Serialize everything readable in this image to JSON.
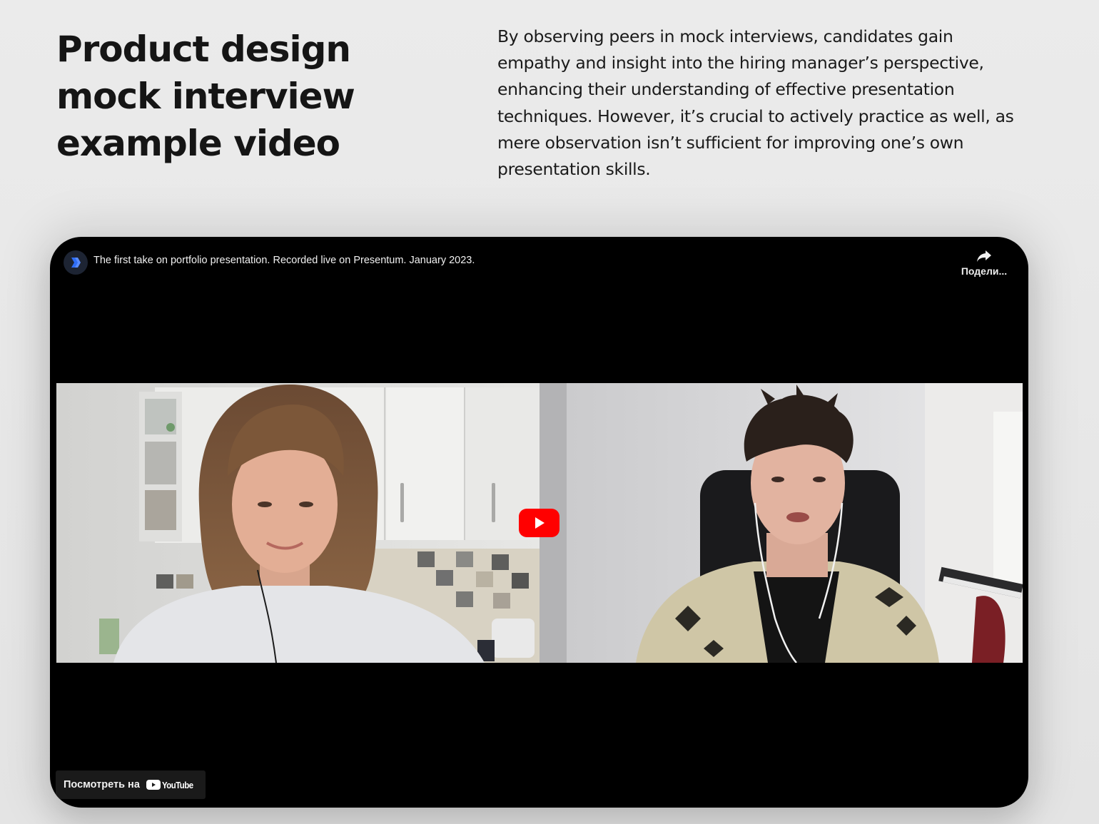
{
  "section": {
    "heading_lines": [
      "Product design",
      "mock interview",
      "example video"
    ],
    "intro_lines": [
      "By observing peers in mock interviews, candidates gain",
      "empathy and insight into the hiring manager’s perspective,",
      "enhancing their understanding of effective presentation",
      "techniques. However, it’s crucial to actively practice as well, as",
      "mere observation isn’t sufficient for improving one’s own",
      "presentation skills."
    ]
  },
  "video": {
    "title": "The first take on portfolio presentation. Recorded live on Presentum. January 2023.",
    "share_label": "Подели...",
    "watch_on_label": "Посмотреть на",
    "youtube_wordmark": "YouTube",
    "icons": {
      "channel": "channel-logo-icon",
      "share": "share-arrow-icon",
      "play": "play-icon",
      "youtube": "youtube-logo-icon"
    },
    "colors": {
      "player_bg": "#000000",
      "play_button": "#ff0000",
      "channel_accent": "#2f6df6"
    }
  }
}
